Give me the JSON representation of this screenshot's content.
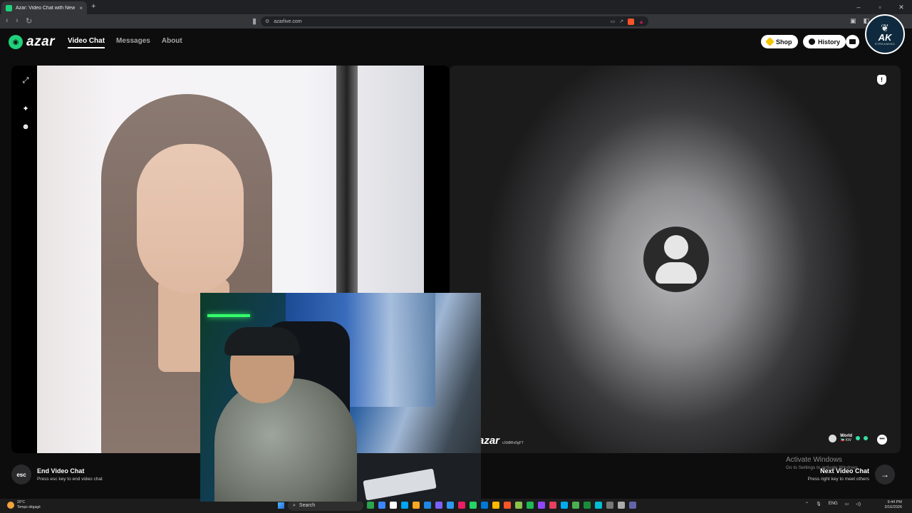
{
  "browser": {
    "tab_title": "Azar: Video Chat with New Pe",
    "tab_close": "×",
    "new_tab": "+",
    "url": "azarlive.com",
    "window_controls": [
      "–",
      "▫",
      "✕"
    ]
  },
  "header": {
    "logo_text": "azar",
    "nav": [
      "Video Chat",
      "Messages",
      "About"
    ],
    "shop_label": "Shop",
    "history_label": "History"
  },
  "badge": {
    "wings": "❦",
    "title": "AK",
    "subtitle": "STREAMING"
  },
  "remote": {
    "watermark": "azar",
    "watermark_id": "cXbBRv0gFT",
    "region": "World",
    "country": "🇰🇼 KW"
  },
  "controls": {
    "end_key": "esc",
    "end_title": "End Video Chat",
    "end_sub": "Press esc key to end video chat",
    "next_title": "Next Video Chat",
    "next_sub": "Press right key to meet others",
    "next_arrow": "→"
  },
  "activate_windows": {
    "title": "Activate Windows",
    "subtitle": "Go to Settings to activate Windows."
  },
  "taskbar": {
    "temperature": "20°C",
    "weather_desc": "Temps dégagé",
    "search_placeholder": "Search",
    "language": "ENG",
    "time": "9:44 PM",
    "date": "3/16/2026",
    "app_colors": [
      "#2aa44f",
      "#3a86ff",
      "#ffffff",
      "#00a4ef",
      "#f9a825",
      "#1e88e5",
      "#7b61ff",
      "#2c98f0",
      "#e91e63",
      "#25d366",
      "#0078d4",
      "#ffb900",
      "#fb542b",
      "#8bc34a",
      "#1db954",
      "#9146ff",
      "#e4405f",
      "#00acee",
      "#4caf50",
      "#1b8c3a",
      "#00bcd4",
      "#777777",
      "#aaaaaa",
      "#6264a7"
    ]
  }
}
